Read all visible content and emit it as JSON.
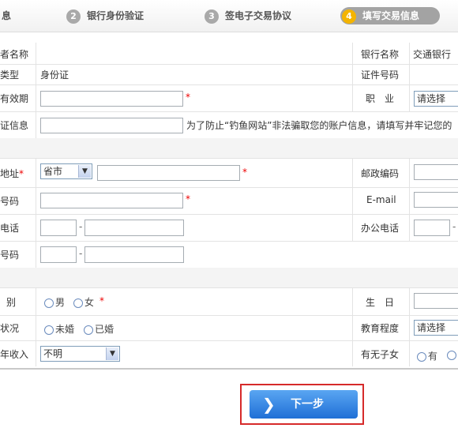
{
  "steps": [
    {
      "num": "",
      "label": "息"
    },
    {
      "num": "2",
      "label": "银行身份验证"
    },
    {
      "num": "3",
      "label": "签电子交易协议"
    },
    {
      "num": "4",
      "label": "填写交易信息"
    }
  ],
  "form": {
    "holder_name_label": "者名称",
    "bank_name_label": "银行名称",
    "bank_name_value": "交通银行",
    "id_type_label": "类型",
    "id_type_value": "身份证",
    "id_number_label": "证件号码",
    "validity_label": "有效期",
    "required_mark": "*",
    "occupation_label": "职　业",
    "occupation_select": "请选择",
    "verify_label": "证信息",
    "verify_hint": "为了防止“钓鱼网站”非法骗取您的账户信息，请填写并牢记您的",
    "address_label": "地址",
    "address_select": "省市",
    "postcode_label": "邮政编码",
    "mobile_label": "号码",
    "email_label": "E-mail",
    "phone_label": "电话",
    "office_phone_label": "办公电话",
    "fax_label": "号码",
    "dash": "-",
    "gender_label": "别",
    "gender_male": "男",
    "gender_female": "女",
    "birthday_label": "生　日",
    "marital_label": "状况",
    "marital_single": "未婚",
    "marital_married": "已婚",
    "education_label": "教育程度",
    "education_select": "请选择",
    "income_label": "年收入",
    "income_select": "不明",
    "children_label": "有无子女",
    "children_yes": "有"
  },
  "next_button": {
    "label": "下一步"
  },
  "colors": {
    "required": "#ee0000",
    "button": "#2a7ddc",
    "highlight_border": "#d62a2a",
    "active_step": "#f4b400"
  }
}
